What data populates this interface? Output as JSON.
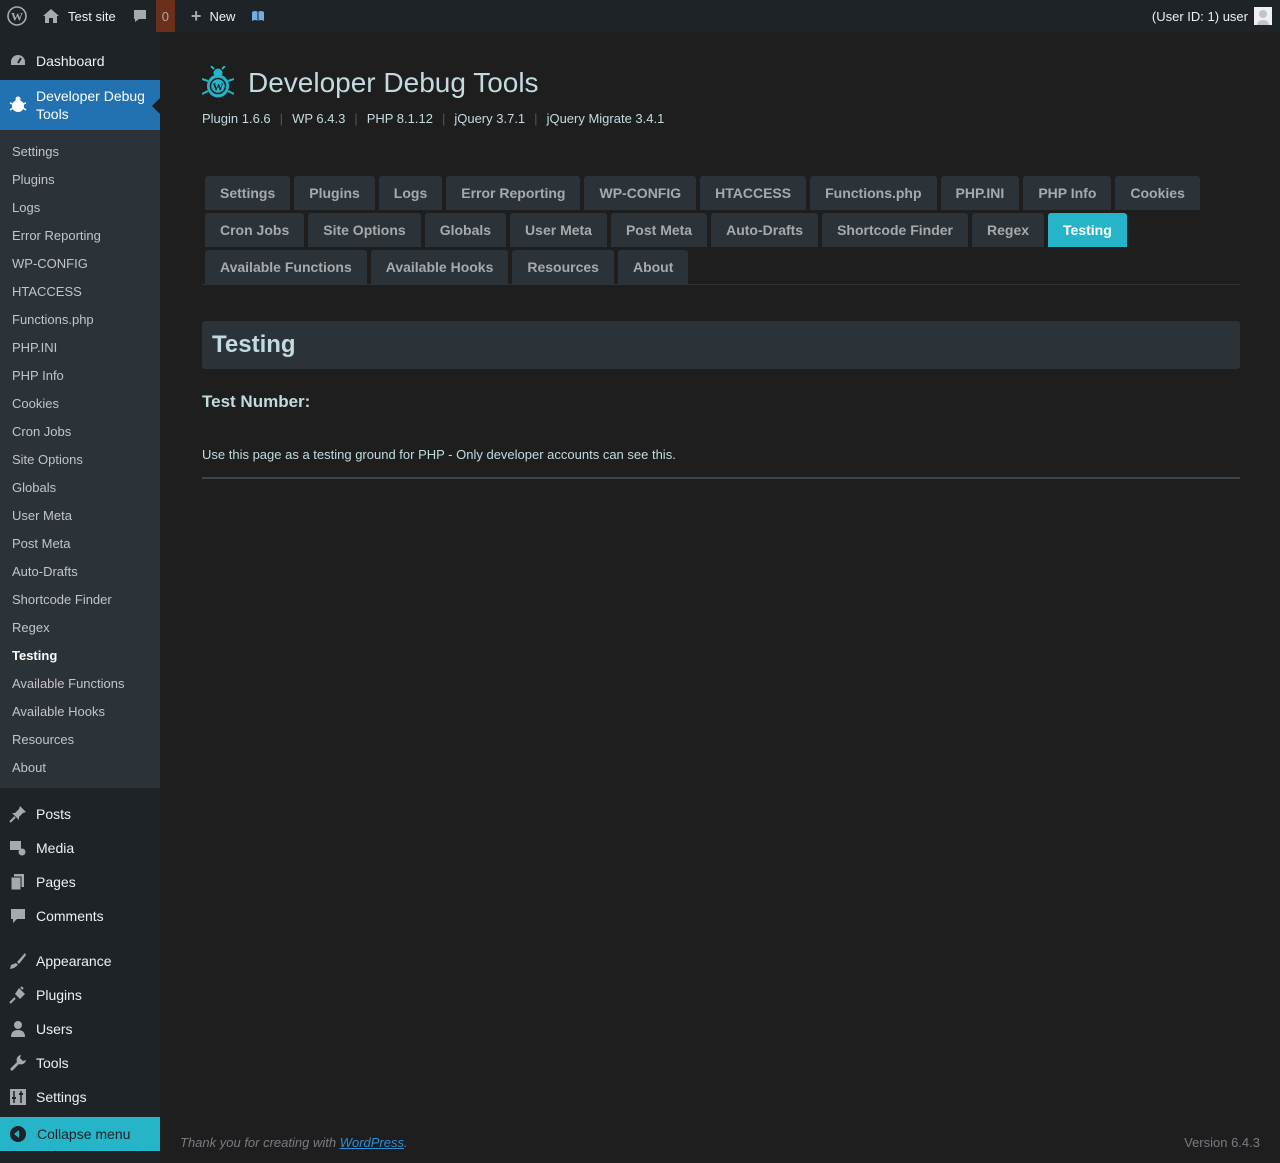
{
  "adminbar": {
    "site_name": "Test site",
    "comment_count": "0",
    "new_label": "New",
    "user_label": "(User ID: 1) user"
  },
  "sidebar": {
    "dashboard": "Dashboard",
    "current": "Developer Debug Tools",
    "submenu": [
      "Settings",
      "Plugins",
      "Logs",
      "Error Reporting",
      "WP-CONFIG",
      "HTACCESS",
      "Functions.php",
      "PHP.INI",
      "PHP Info",
      "Cookies",
      "Cron Jobs",
      "Site Options",
      "Globals",
      "User Meta",
      "Post Meta",
      "Auto-Drafts",
      "Shortcode Finder",
      "Regex",
      "Testing",
      "Available Functions",
      "Available Hooks",
      "Resources",
      "About"
    ],
    "posts": "Posts",
    "media": "Media",
    "pages": "Pages",
    "comments": "Comments",
    "appearance": "Appearance",
    "plugins": "Plugins",
    "users": "Users",
    "tools": "Tools",
    "settings": "Settings",
    "collapse": "Collapse menu"
  },
  "header": {
    "title": "Developer Debug Tools",
    "versions": [
      "Plugin 1.6.6",
      "WP 6.4.3",
      "PHP 8.1.12",
      "jQuery 3.7.1",
      "jQuery Migrate 3.4.1"
    ]
  },
  "tabs": {
    "row1": [
      "Settings",
      "Plugins",
      "Logs",
      "Error Reporting",
      "WP-CONFIG",
      "HTACCESS",
      "Functions.php",
      "PHP.INI",
      "PHP Info",
      "Cookies"
    ],
    "row2": [
      "Cron Jobs",
      "Site Options",
      "Globals",
      "User Meta",
      "Post Meta",
      "Auto-Drafts",
      "Shortcode Finder",
      "Regex",
      "Testing"
    ],
    "row3": [
      "Available Functions",
      "Available Hooks",
      "Resources",
      "About"
    ],
    "active": "Testing"
  },
  "content": {
    "heading": "Testing",
    "test_number_label": "Test Number:",
    "description": "Use this page as a testing ground for PHP - Only developer accounts can see this."
  },
  "footer": {
    "thanks_prefix": "Thank you for creating with ",
    "thanks_link": "WordPress",
    "thanks_suffix": ".",
    "version": "Version 6.4.3"
  },
  "colors": {
    "accent": "#25b4c8",
    "sidebar": "#1d2327",
    "current_menu": "#2271b1"
  }
}
